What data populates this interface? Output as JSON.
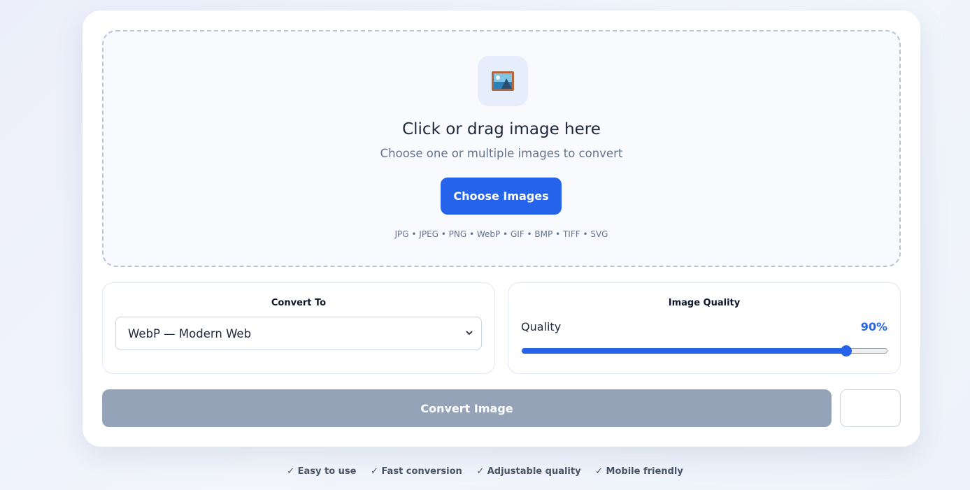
{
  "dropzone": {
    "title": "Click or drag image here",
    "subtitle": "Choose one or multiple images to convert",
    "choose_label": "Choose Images",
    "formats": "JPG • JPEG • PNG • WebP • GIF • BMP • TIFF • SVG",
    "icon": "framed-picture-icon"
  },
  "convert_to": {
    "title": "Convert To",
    "selected": "WebP — Modern Web"
  },
  "quality": {
    "title": "Image Quality",
    "label": "Quality",
    "value_text": "90%",
    "value": 90
  },
  "actions": {
    "convert_label": "Convert Image"
  },
  "features": [
    "✓ Easy to use",
    "✓ Fast conversion",
    "✓ Adjustable quality",
    "✓ Mobile friendly"
  ],
  "colors": {
    "accent": "#2563eb",
    "disabled": "#94a3b8",
    "icon_bg": "#e6edfb"
  }
}
